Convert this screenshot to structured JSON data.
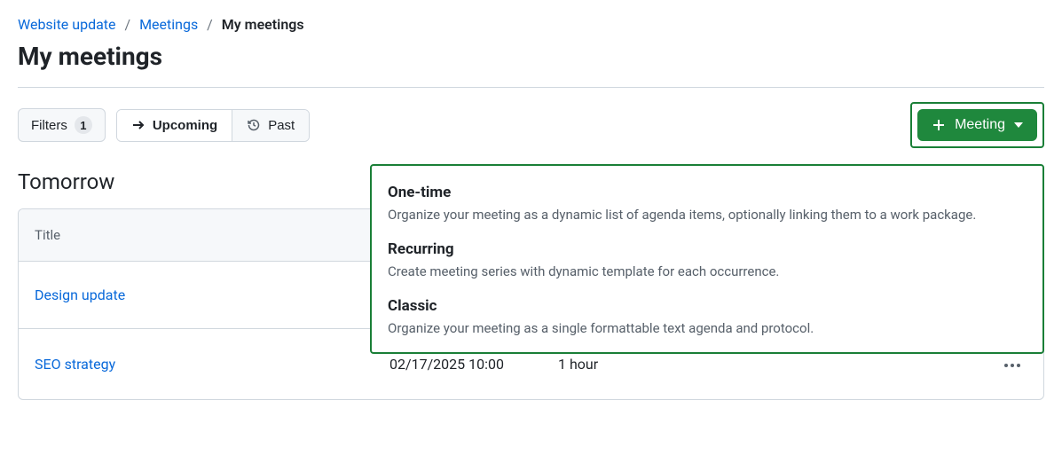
{
  "breadcrumb": {
    "project": "Website update",
    "section": "Meetings",
    "current": "My meetings"
  },
  "page_title": "My meetings",
  "toolbar": {
    "filters_label": "Filters",
    "filters_count": "1",
    "upcoming_label": "Upcoming",
    "past_label": "Past",
    "meeting_button_label": "Meeting"
  },
  "dropdown": {
    "items": [
      {
        "title": "One-time",
        "desc": "Organize your meeting as a dynamic list of agenda items, optionally linking them to a work package."
      },
      {
        "title": "Recurring",
        "desc": "Create meeting series with dynamic template for each occurrence."
      },
      {
        "title": "Classic",
        "desc": "Organize your meeting as a single formattable text agenda and protocol."
      }
    ]
  },
  "section_heading": "Tomorrow",
  "table": {
    "header_title": "Title",
    "rows": [
      {
        "title": "Design update",
        "date": "",
        "duration": ""
      },
      {
        "title": "SEO strategy",
        "date": "02/17/2025 10:00",
        "duration": "1 hour"
      }
    ]
  }
}
